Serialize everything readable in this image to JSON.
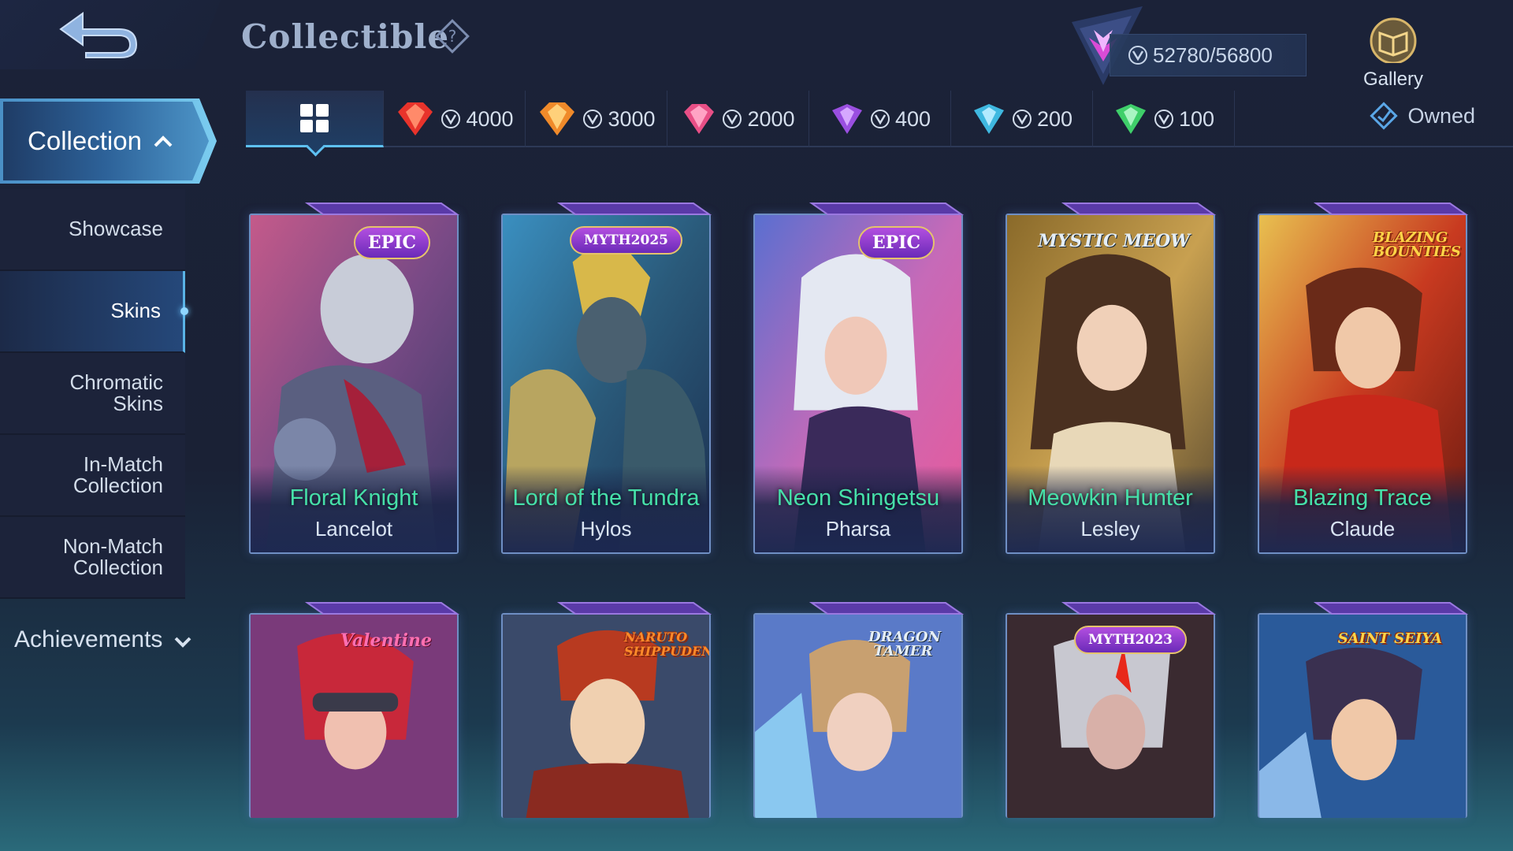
{
  "header": {
    "title": "Collectible",
    "points": "52780/56800",
    "gallery_label": "Gallery"
  },
  "sidebar": {
    "collection_label": "Collection",
    "items": [
      {
        "label": "Showcase"
      },
      {
        "label": "Skins"
      },
      {
        "label": "Chromatic Skins"
      },
      {
        "label": "In-Match Collection"
      },
      {
        "label": "Non-Match Collection"
      }
    ],
    "achievements_label": "Achievements"
  },
  "tabs": [
    {
      "value": "4000",
      "color": "#e8332b"
    },
    {
      "value": "3000",
      "color": "#f08a2a"
    },
    {
      "value": "2000",
      "color": "#e84f86"
    },
    {
      "value": "400",
      "color": "#9a4fe0"
    },
    {
      "value": "200",
      "color": "#3fb8e0"
    },
    {
      "value": "100",
      "color": "#3fcf6a"
    }
  ],
  "owned_label": "Owned",
  "cards": [
    {
      "skin": "Floral Knight",
      "hero": "Lancelot",
      "badge": "EPIC"
    },
    {
      "skin": "Lord of the Tundra",
      "hero": "Hylos",
      "badge": "MYTH2025"
    },
    {
      "skin": "Neon Shingetsu",
      "hero": "Pharsa",
      "badge": "EPIC"
    },
    {
      "skin": "Meowkin Hunter",
      "hero": "Lesley",
      "badge": "MYSTIC MEOW"
    },
    {
      "skin": "Blazing Trace",
      "hero": "Claude",
      "badge": "BLAZING BOUNTIES"
    },
    {
      "badge": "Valentine"
    },
    {
      "badge": "NARUTO SHIPPUDEN"
    },
    {
      "badge": "DRAGON TAMER"
    },
    {
      "badge": "MYTH2023"
    },
    {
      "badge": "SAINT SEIYA"
    }
  ],
  "colors": {
    "accent": "#5ec1f2",
    "skin_name": "#46e0a9",
    "background": "#1b2238"
  },
  "icons": [
    "back-arrow-icon",
    "help-diamond-icon",
    "points-emblem-icon",
    "coin-icon",
    "gallery-icon",
    "grid-icon",
    "gem-icon",
    "owned-diamond-icon",
    "chevron-up-icon",
    "chevron-down-icon"
  ]
}
